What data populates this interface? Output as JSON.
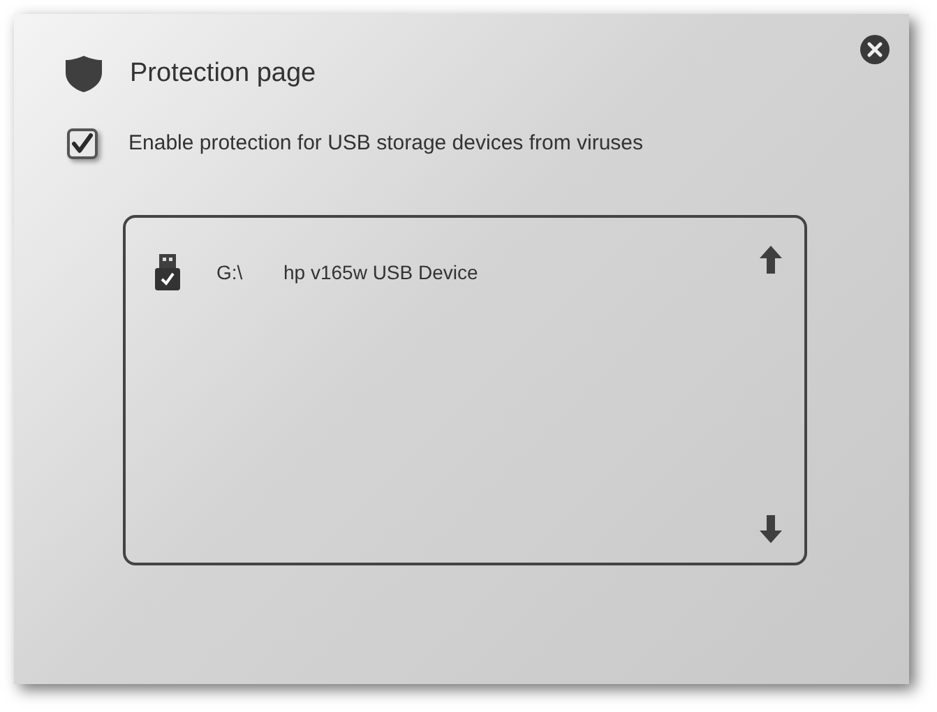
{
  "window": {
    "title": "Protection page"
  },
  "protection": {
    "label": "Enable protection for USB storage devices from viruses",
    "checked": true
  },
  "devices": [
    {
      "drive": "G:\\",
      "name": "hp v165w USB Device",
      "protected": true
    }
  ]
}
